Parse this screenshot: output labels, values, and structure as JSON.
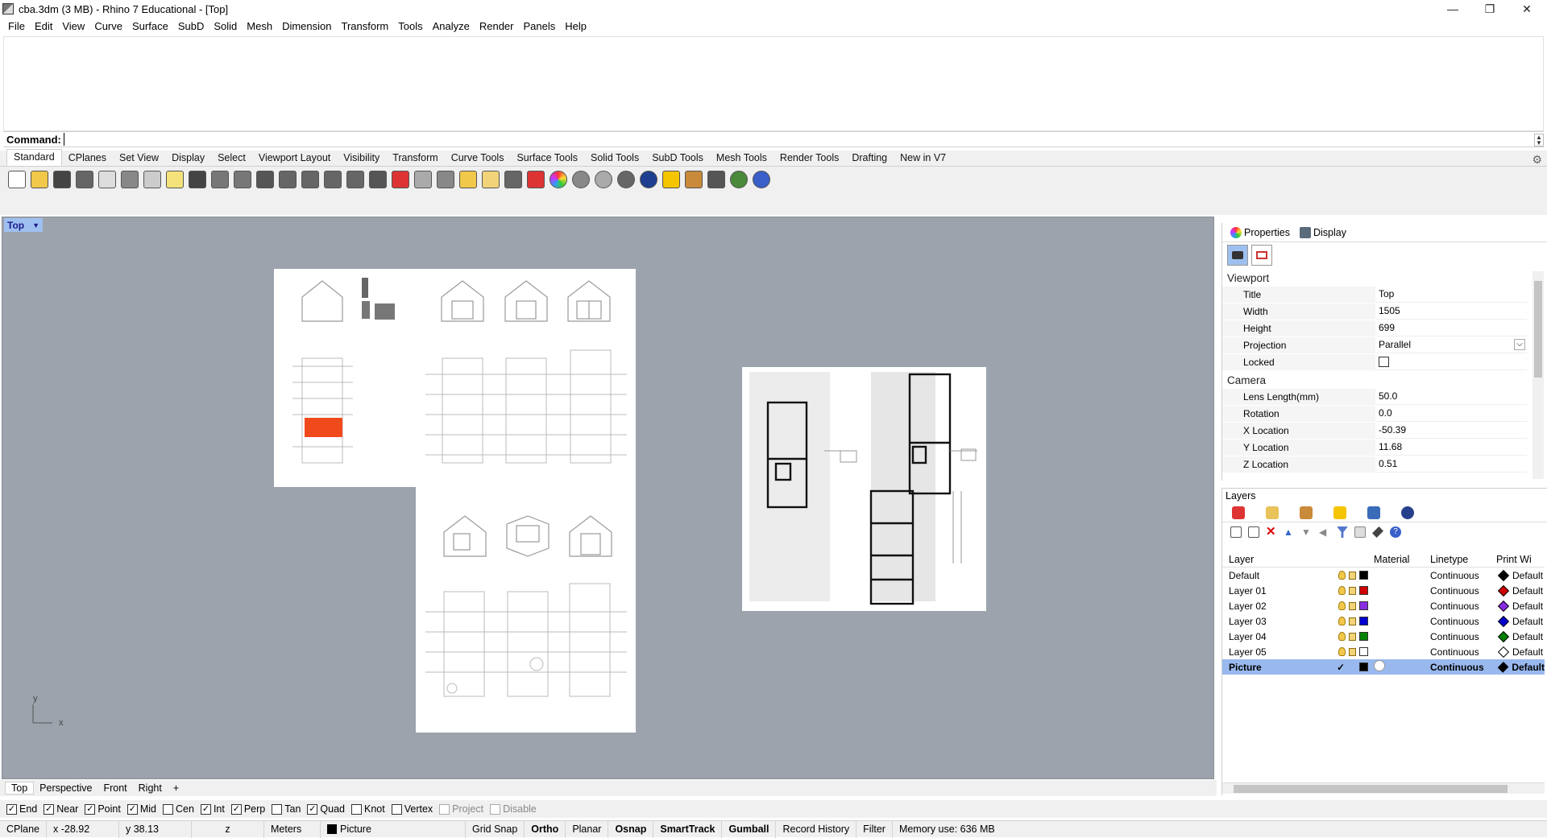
{
  "window": {
    "title": "cba.3dm (3 MB) - Rhino 7 Educational - [Top]",
    "controls": {
      "minimize": "—",
      "maximize": "❐",
      "close": "✕"
    }
  },
  "menu": [
    "File",
    "Edit",
    "View",
    "Curve",
    "Surface",
    "SubD",
    "Solid",
    "Mesh",
    "Dimension",
    "Transform",
    "Tools",
    "Analyze",
    "Render",
    "Panels",
    "Help"
  ],
  "command": {
    "label": "Command:",
    "value": ""
  },
  "toolbar_tabs": [
    "Standard",
    "CPlanes",
    "Set View",
    "Display",
    "Select",
    "Viewport Layout",
    "Visibility",
    "Transform",
    "Curve Tools",
    "Surface Tools",
    "Solid Tools",
    "SubD Tools",
    "Mesh Tools",
    "Render Tools",
    "Drafting",
    "New in V7"
  ],
  "toolbar_active": "Standard",
  "toolbar_icons": [
    "new-icon",
    "open-icon",
    "save-icon",
    "print-icon",
    "import-icon",
    "cut-icon",
    "copy-icon",
    "paste-icon",
    "undo-icon",
    "pan-icon",
    "rotate-view-icon",
    "zoom-icon",
    "zoom-window-icon",
    "zoom-extents-icon",
    "zoom-selected-icon",
    "zoom-all-icon",
    "four-viewports-icon",
    "car-icon",
    "car-section-icon",
    "cplane-icon",
    "points-icon",
    "light-icon",
    "lock-icon",
    "layer-icon",
    "color-wheel-icon",
    "material-sphere-icon",
    "render-sphere-icon",
    "shaded-sphere-icon",
    "render-icon",
    "filter-icon",
    "options-icon",
    "dims-icon",
    "globe-icon",
    "help-icon"
  ],
  "viewport": {
    "name": "Top",
    "axis_x": "x",
    "axis_y": "y"
  },
  "viewport_tabs": [
    "Top",
    "Perspective",
    "Front",
    "Right",
    "+"
  ],
  "osnaps": [
    {
      "label": "End",
      "checked": true
    },
    {
      "label": "Near",
      "checked": true
    },
    {
      "label": "Point",
      "checked": true
    },
    {
      "label": "Mid",
      "checked": true
    },
    {
      "label": "Cen",
      "checked": false
    },
    {
      "label": "Int",
      "checked": true
    },
    {
      "label": "Perp",
      "checked": true
    },
    {
      "label": "Tan",
      "checked": false
    },
    {
      "label": "Quad",
      "checked": true
    },
    {
      "label": "Knot",
      "checked": false
    },
    {
      "label": "Vertex",
      "checked": false
    },
    {
      "label": "Project",
      "checked": false,
      "dim": true
    },
    {
      "label": "Disable",
      "checked": false,
      "dim": true
    }
  ],
  "status": {
    "cplane": "CPlane",
    "x": "x -28.92",
    "y": "y 38.13",
    "z": "z",
    "units": "Meters",
    "layer": "Picture",
    "grid_snap": "Grid Snap",
    "ortho": "Ortho",
    "planar": "Planar",
    "osnap": "Osnap",
    "smarttrack": "SmartTrack",
    "gumball": "Gumball",
    "record_history": "Record History",
    "filter": "Filter",
    "memory": "Memory use: 636 MB"
  },
  "properties": {
    "tabs": [
      "Properties",
      "Display"
    ],
    "viewport_section": "Viewport",
    "viewport_rows": [
      {
        "label": "Title",
        "value": "Top"
      },
      {
        "label": "Width",
        "value": "1505"
      },
      {
        "label": "Height",
        "value": "699"
      },
      {
        "label": "Projection",
        "value": "Parallel"
      },
      {
        "label": "Locked",
        "value": ""
      }
    ],
    "camera_section": "Camera",
    "camera_rows": [
      {
        "label": "Lens Length(mm)",
        "value": "50.0"
      },
      {
        "label": "Rotation",
        "value": "0.0"
      },
      {
        "label": "X Location",
        "value": "-50.39"
      },
      {
        "label": "Y Location",
        "value": "11.68"
      },
      {
        "label": "Z Location",
        "value": "0.51"
      }
    ]
  },
  "layers": {
    "title": "Layers",
    "columns": {
      "layer": "Layer",
      "material": "Material",
      "linetype": "Linetype",
      "print_width": "Print Wi"
    },
    "rows": [
      {
        "name": "Default",
        "color": "#000000",
        "linetype": "Continuous",
        "print": "Default",
        "diamond": "#000000"
      },
      {
        "name": "Layer 01",
        "color": "#d00000",
        "linetype": "Continuous",
        "print": "Default",
        "diamond": "#d00000"
      },
      {
        "name": "Layer 02",
        "color": "#8a2be2",
        "linetype": "Continuous",
        "print": "Default",
        "diamond": "#8a2be2"
      },
      {
        "name": "Layer 03",
        "color": "#0000d0",
        "linetype": "Continuous",
        "print": "Default",
        "diamond": "#0000d0"
      },
      {
        "name": "Layer 04",
        "color": "#008000",
        "linetype": "Continuous",
        "print": "Default",
        "diamond": "#008000"
      },
      {
        "name": "Layer 05",
        "color": "#ffffff",
        "linetype": "Continuous",
        "print": "Default",
        "diamond": "#ffffff"
      },
      {
        "name": "Picture",
        "color": "#000000",
        "linetype": "Continuous",
        "print": "Default",
        "diamond": "#000000",
        "selected": true,
        "current": true
      }
    ]
  },
  "colors": {
    "viewport_bg": "#9ca3ad",
    "selection": "#99b9ee",
    "accent_red": "#f04a1c"
  }
}
